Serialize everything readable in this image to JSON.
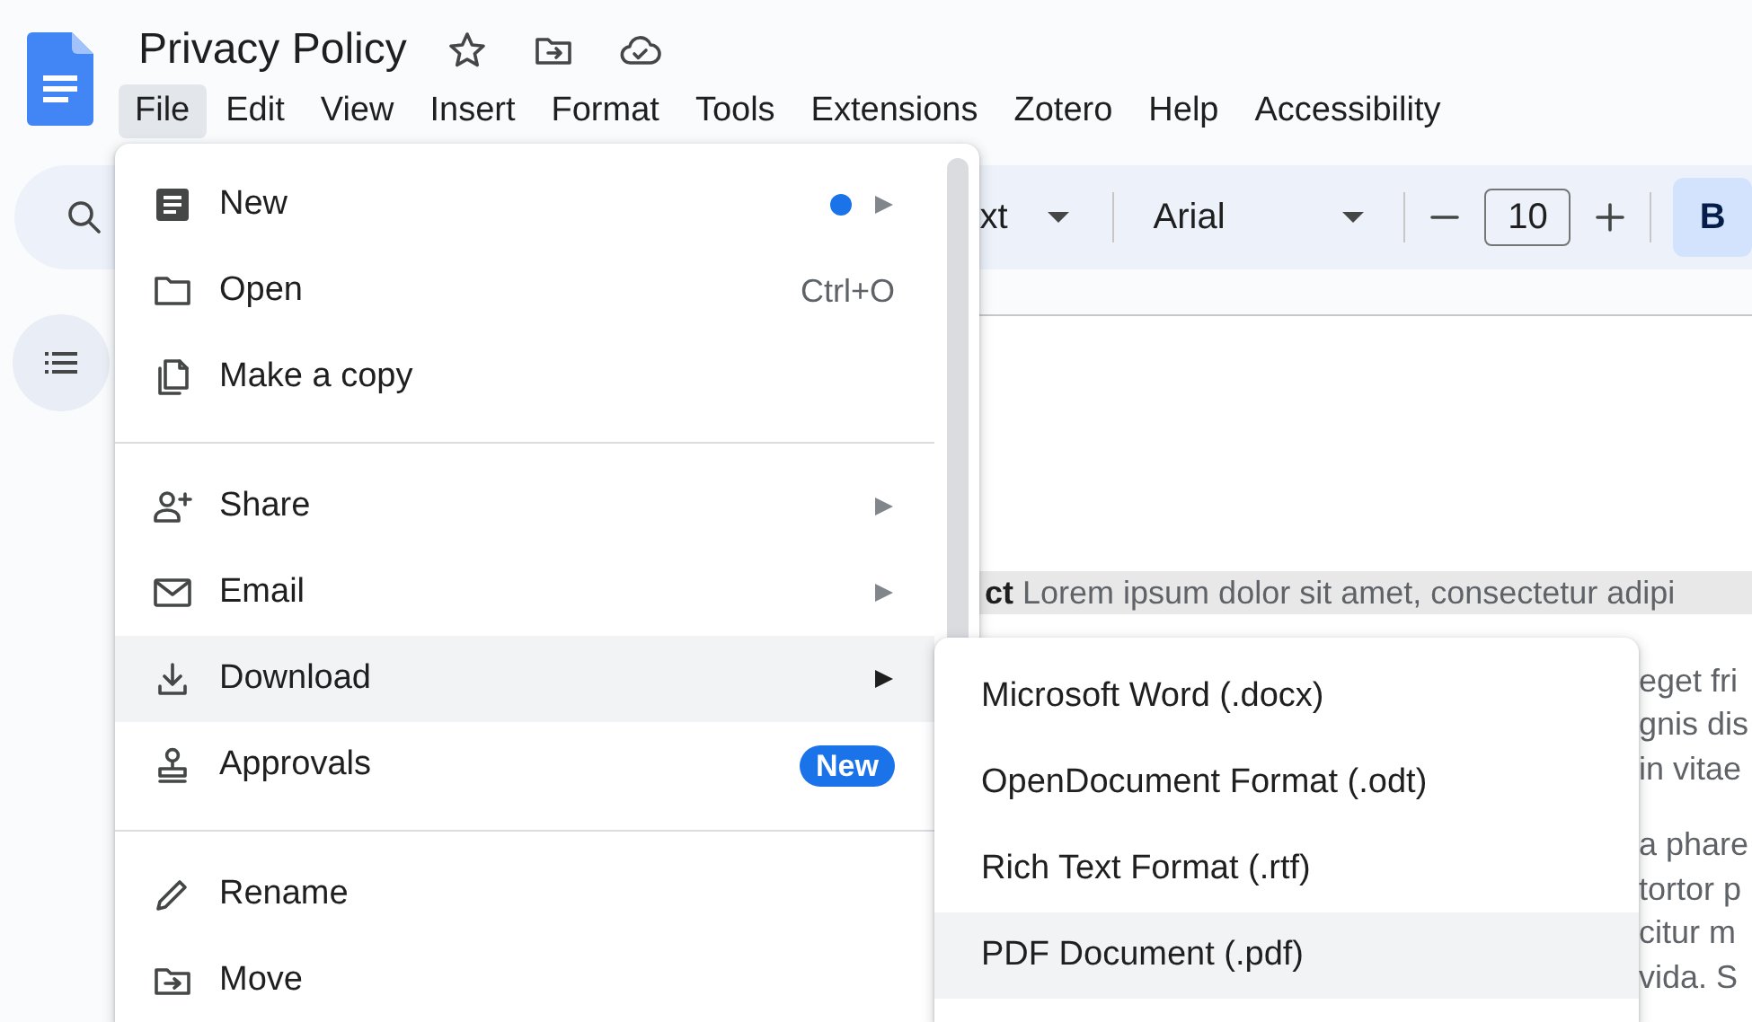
{
  "document_title": "Privacy Policy",
  "menubar": [
    {
      "label": "File",
      "selected": true
    },
    {
      "label": "Edit",
      "selected": false
    },
    {
      "label": "View",
      "selected": false
    },
    {
      "label": "Insert",
      "selected": false
    },
    {
      "label": "Format",
      "selected": false
    },
    {
      "label": "Tools",
      "selected": false
    },
    {
      "label": "Extensions",
      "selected": false
    },
    {
      "label": "Zotero",
      "selected": false
    },
    {
      "label": "Help",
      "selected": false
    },
    {
      "label": "Accessibility",
      "selected": false
    }
  ],
  "toolbar": {
    "style_text": "xt",
    "font": "Arial",
    "font_size": "10",
    "bold_label": "B"
  },
  "file_menu": [
    {
      "kind": "item",
      "label": "New",
      "dot": true,
      "submenu": true,
      "selected": false
    },
    {
      "kind": "item",
      "label": "Open",
      "shortcut": "Ctrl+O",
      "submenu": false,
      "selected": false
    },
    {
      "kind": "item",
      "label": "Make a copy",
      "submenu": false,
      "selected": false
    },
    {
      "kind": "divider"
    },
    {
      "kind": "item",
      "label": "Share",
      "submenu": true,
      "selected": false
    },
    {
      "kind": "item",
      "label": "Email",
      "submenu": true,
      "selected": false
    },
    {
      "kind": "item",
      "label": "Download",
      "submenu": true,
      "selected": true
    },
    {
      "kind": "item",
      "label": "Approvals",
      "badge": "New",
      "submenu": false,
      "selected": false
    },
    {
      "kind": "divider"
    },
    {
      "kind": "item",
      "label": "Rename",
      "submenu": false,
      "selected": false
    },
    {
      "kind": "item",
      "label": "Move",
      "submenu": false,
      "selected": false
    }
  ],
  "download_submenu": [
    {
      "label": "Microsoft Word (.docx)",
      "selected": false
    },
    {
      "label": "OpenDocument Format (.odt)",
      "selected": false
    },
    {
      "label": "Rich Text Format (.rtf)",
      "selected": false
    },
    {
      "label": "PDF Document (.pdf)",
      "selected": true
    }
  ],
  "document": {
    "first_line": {
      "text": "**ct** Lorem ipsum dolor sit amet, consectetur adipi",
      "highlighted": true
    },
    "paragraphs": [
      [
        "eget fri",
        "gnis dis",
        "in vitae"
      ],
      [
        "a phare",
        "tortor p",
        "citur m",
        "vida. S"
      ]
    ]
  }
}
